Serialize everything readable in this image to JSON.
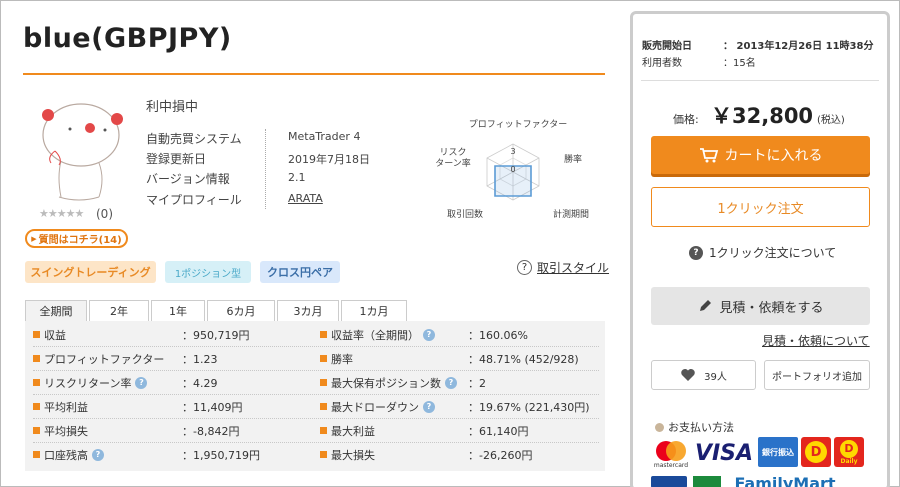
{
  "title": "blue(GBPJPY)",
  "product": {
    "status": "利中損中",
    "rating_count": "(0)",
    "stars": "★★★★★",
    "question_button": "質問はコチラ(14)",
    "info": [
      {
        "key": "自動売買システム",
        "value": "MetaTrader 4"
      },
      {
        "key": "登録更新日",
        "value": "2019年7月18日"
      },
      {
        "key": "バージョン情報",
        "value": "2.1"
      },
      {
        "key": "マイプロフィール",
        "value": "ARATA"
      }
    ]
  },
  "radar": {
    "axes": [
      "プロフィットファクター",
      "勝率",
      "計測期間",
      "取引回数",
      "リスク",
      "ターン率"
    ],
    "scale_max_label": "3",
    "scale_min_label": "0",
    "accent": "#5b9bd5"
  },
  "tags": [
    "スイングトレーディング",
    "1ポジション型",
    "クロス円ペア"
  ],
  "trade_style": {
    "icon": "?",
    "label": "取引スタイル"
  },
  "tabs": [
    "全期間",
    "2年",
    "1年",
    "6カ月",
    "3カ月",
    "1カ月"
  ],
  "stats": {
    "left": [
      {
        "label": "収益",
        "value": "：950,719円",
        "help": false
      },
      {
        "label": "プロフィットファクター",
        "value": "：1.23",
        "help": false
      },
      {
        "label": "リスクリターン率",
        "value": "：4.29",
        "help": true
      },
      {
        "label": "平均利益",
        "value": "：11,409円",
        "help": false
      },
      {
        "label": "平均損失",
        "value": "：-8,842円",
        "help": false
      },
      {
        "label": "口座残高",
        "value": "：1,950,719円",
        "help": true
      }
    ],
    "right": [
      {
        "label": "収益率（全期間）",
        "value": "：160.06%",
        "help": true
      },
      {
        "label": "勝率",
        "value": "：48.71% (452/928)",
        "help": false
      },
      {
        "label": "最大保有ポジション数",
        "value": "：2",
        "help": true
      },
      {
        "label": "最大ドローダウン",
        "value": "：19.67% (221,430円)",
        "help": true
      },
      {
        "label": "最大利益",
        "value": "：61,140円",
        "help": false
      },
      {
        "label": "最大損失",
        "value": "：-26,260円",
        "help": false
      }
    ]
  },
  "panel": {
    "sale_start_label": "販売開始日",
    "sale_start_value": "：  2013年12月26日 11時38分",
    "users_label": "利用者数",
    "users_value": "：15名",
    "price_label": "価格:",
    "price": "￥32,800",
    "tax": "(税込)",
    "cart_button": "カートに入れる",
    "oneclick_button": "1クリック注文",
    "oneclick_about": "1クリック注文について",
    "estimate_button": "見積・依頼をする",
    "estimate_about": "見積・依頼について",
    "favorites_count": "39人",
    "portfolio_button": "ポートフォリオ追加",
    "payment_title": "お支払い方法",
    "payment_logos": {
      "mastercard": "mastercard",
      "visa": "VISA",
      "bank": "銀行振込",
      "daily1": "D",
      "daily2": "D",
      "daily_label": "Daily",
      "familymart": "FamilyMart"
    }
  },
  "colors": {
    "accent": "#f08a1d",
    "help": "#8fb8dd"
  }
}
